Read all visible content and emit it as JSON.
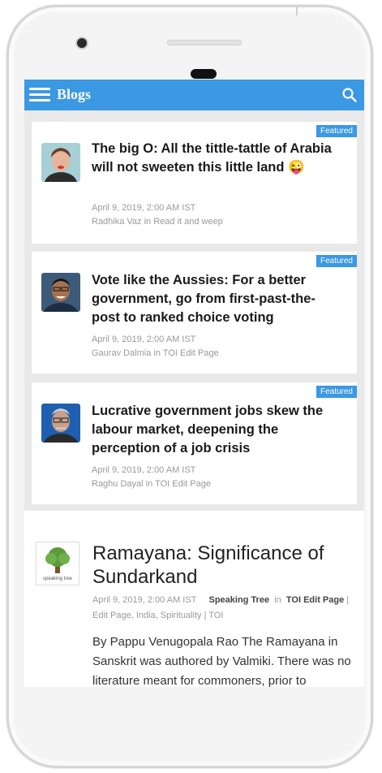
{
  "appbar": {
    "title": "Blogs",
    "menu_icon": "hamburger-icon",
    "search_icon": "search-icon",
    "color": "#3b98e3"
  },
  "cards": [
    {
      "badge": "Featured",
      "title": "The big O: All the tittle-tattle of Arabia will not sweeten this little land",
      "emoji": "😜",
      "date": "April 9, 2019, 2:00 AM IST",
      "author_line": "Radhika Vaz in Read it and weep"
    },
    {
      "badge": "Featured",
      "title": "Vote like the Aussies: For a better government, go from first-past-the-post to ranked choice voting",
      "date": "April 9, 2019, 2:00 AM IST",
      "author_line": "Gaurav Dalmia in TOI Edit Page"
    },
    {
      "badge": "Featured",
      "title": "Lucrative government jobs skew the labour market, deepening the perception of a job crisis",
      "date": "April 9, 2019, 2:00 AM IST",
      "author_line": "Raghu Dayal in TOI Edit Page"
    }
  ],
  "article": {
    "title": "Ramayana: Significance of Sundarkand",
    "date": "April 9, 2019, 2:00 AM IST",
    "author": "Speaking Tree",
    "in_word": "in",
    "section": "TOI Edit Page",
    "tags": "| Edit Page, India, Spirituality | TOI",
    "body": "By Pappu Venugopala Rao The Ramayana in Sanskrit was authored by Valmiki. There was no literature meant for commoners, prior to",
    "logo_text": "speaking tree"
  }
}
